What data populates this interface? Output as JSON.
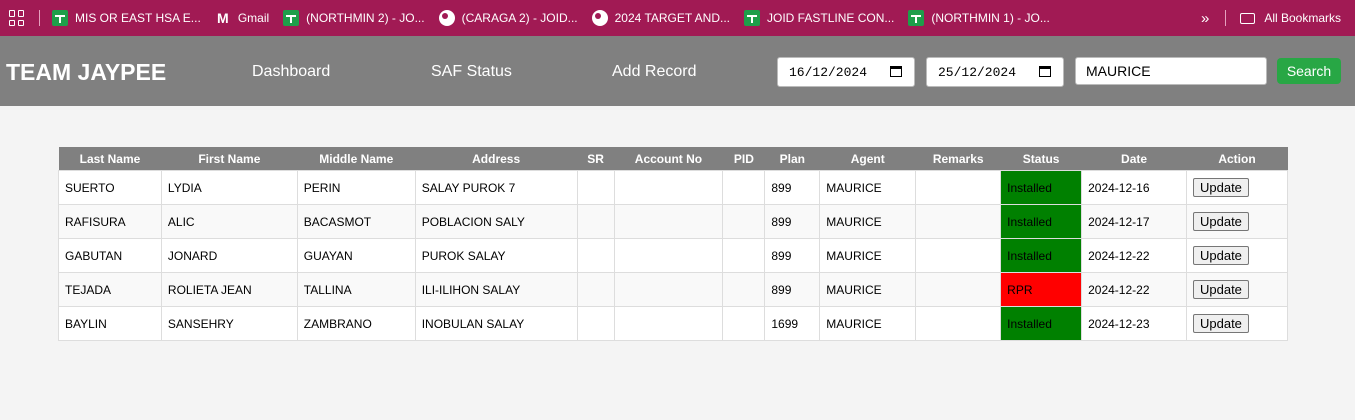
{
  "bookmarks": [
    {
      "label": "MIS OR EAST HSA E...",
      "icon": "sheets-icon"
    },
    {
      "label": "Gmail",
      "icon": "gmail-icon"
    },
    {
      "label": "(NORTHMIN 2) - JO...",
      "icon": "sheets-icon"
    },
    {
      "label": "(CARAGA 2) - JOID...",
      "icon": "globe-icon"
    },
    {
      "label": "2024 TARGET AND...",
      "icon": "globe-icon"
    },
    {
      "label": "JOID FASTLINE CON...",
      "icon": "sheets-icon"
    },
    {
      "label": "(NORTHMIN 1) - JO...",
      "icon": "sheets-icon"
    }
  ],
  "bookmarks_more": "»",
  "all_bookmarks": "All Bookmarks",
  "header": {
    "brand": "TEAM JAYPEE",
    "nav": [
      "Dashboard",
      "SAF Status",
      "Add Record"
    ],
    "date_from": "16/12/2024",
    "date_to": "25/12/2024",
    "search_value": "MAURICE",
    "search_button": "Search"
  },
  "table": {
    "columns": [
      "Last Name",
      "First Name",
      "Middle Name",
      "Address",
      "SR",
      "Account No",
      "PID",
      "Plan",
      "Agent",
      "Remarks",
      "Status",
      "Date",
      "Action"
    ],
    "rows": [
      {
        "last": "SUERTO",
        "first": "LYDIA",
        "middle": "PERIN",
        "address": "SALAY PUROK 7",
        "sr": "",
        "account": "",
        "pid": "",
        "plan": "899",
        "agent": "MAURICE",
        "remarks": "",
        "status": "Installed",
        "date": "2024-12-16",
        "action": "Update"
      },
      {
        "last": "RAFISURA",
        "first": "ALIC",
        "middle": "BACASMOT",
        "address": "POBLACION SALY",
        "sr": "",
        "account": "",
        "pid": "",
        "plan": "899",
        "agent": "MAURICE",
        "remarks": "",
        "status": "Installed",
        "date": "2024-12-17",
        "action": "Update"
      },
      {
        "last": "GABUTAN",
        "first": "JONARD",
        "middle": "GUAYAN",
        "address": "PUROK SALAY",
        "sr": "",
        "account": "",
        "pid": "",
        "plan": "899",
        "agent": "MAURICE",
        "remarks": "",
        "status": "Installed",
        "date": "2024-12-22",
        "action": "Update"
      },
      {
        "last": "TEJADA",
        "first": "ROLIETA JEAN",
        "middle": "TALLINA",
        "address": "ILI-ILIHON SALAY",
        "sr": "",
        "account": "",
        "pid": "",
        "plan": "899",
        "agent": "MAURICE",
        "remarks": "",
        "status": "RPR",
        "date": "2024-12-22",
        "action": "Update"
      },
      {
        "last": "BAYLIN",
        "first": "SANSEHRY",
        "middle": "ZAMBRANO",
        "address": "INOBULAN SALAY",
        "sr": "",
        "account": "",
        "pid": "",
        "plan": "1699",
        "agent": "MAURICE",
        "remarks": "",
        "status": "Installed",
        "date": "2024-12-23",
        "action": "Update"
      }
    ]
  },
  "colors": {
    "bookmarks_bar": "#a11a54",
    "header": "#808080",
    "status_installed": "#008000",
    "status_rpr": "#ff0000",
    "search_button": "#28a745"
  }
}
